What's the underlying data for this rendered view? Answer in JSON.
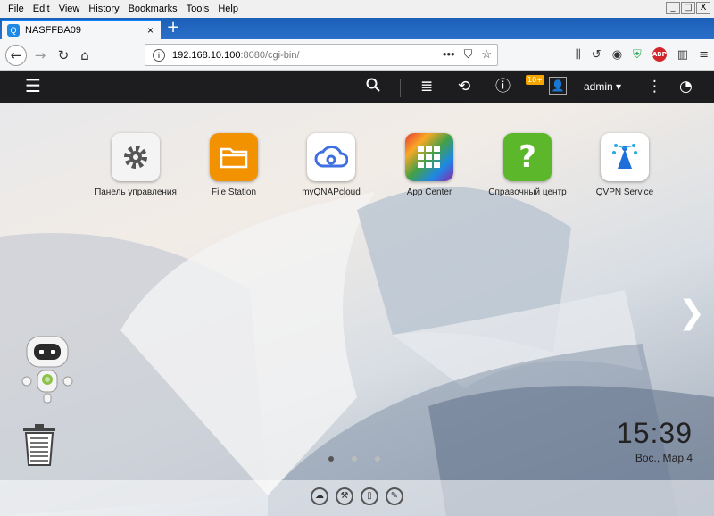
{
  "browser": {
    "menu": [
      "File",
      "Edit",
      "View",
      "History",
      "Bookmarks",
      "Tools",
      "Help"
    ],
    "window_controls": [
      "_",
      "□",
      "X"
    ],
    "tab_title": "NASFFBA09",
    "tab_close": "×",
    "new_tab": "+",
    "url_host": "192.168.10.100",
    "url_path": ":8080/cgi-bin/",
    "url_dots": "•••",
    "abp_label": "ABP"
  },
  "qts": {
    "notification_badge": "10+",
    "username": "admin ▾"
  },
  "apps": [
    {
      "label": "Панель управления",
      "icon": "gear-icon",
      "color": "#f2f2f2"
    },
    {
      "label": "File Station",
      "icon": "folder-icon",
      "color": "#f39200"
    },
    {
      "label": "myQNAPcloud",
      "icon": "cloud-icon",
      "color": "#ffffff"
    },
    {
      "label": "App Center",
      "icon": "grid-icon",
      "color": "#e53935"
    },
    {
      "label": "Справочный центр",
      "icon": "question-icon",
      "color": "#5cb82a"
    },
    {
      "label": "QVPN Service",
      "icon": "vpn-icon",
      "color": "#ffffff"
    }
  ],
  "clock": {
    "time": "15:39",
    "date": "Вос., Мар 4"
  }
}
